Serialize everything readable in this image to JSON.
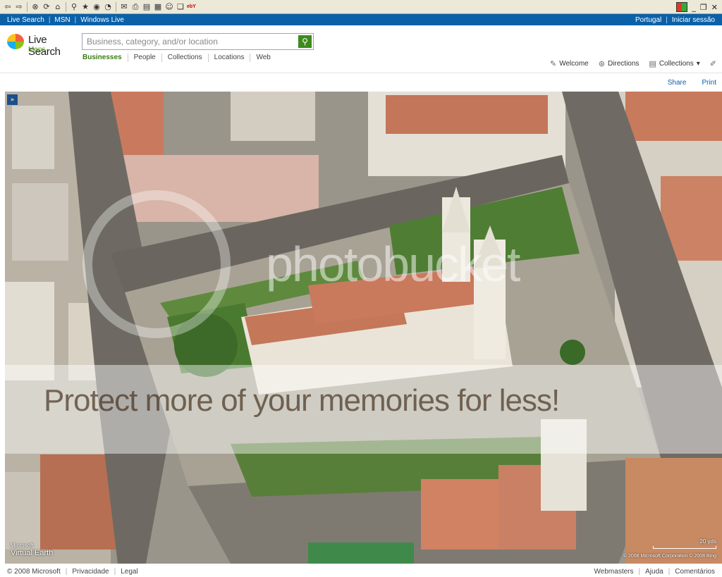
{
  "topbar": {
    "left_links": [
      "Live Search",
      "MSN",
      "Windows Live"
    ],
    "region": "Portugal",
    "signin": "Iniciar sessão"
  },
  "logo": {
    "brand": "Live Search",
    "product": "Maps"
  },
  "search": {
    "placeholder": "Business, category, and/or location"
  },
  "search_tabs": [
    "Businesses",
    "People",
    "Collections",
    "Locations",
    "Web"
  ],
  "actions": {
    "welcome": "Welcome",
    "directions": "Directions",
    "collections": "Collections"
  },
  "share": "Share",
  "print": "Print",
  "map": {
    "watermark_brand": "photobucket",
    "watermark_slogan": "Protect more of your memories for less!",
    "provider_small": "Microsoft",
    "provider": "Virtual Earth",
    "scale": "20 yds",
    "copyright": "© 2008 Microsoft Corporation   © 2008 Bing"
  },
  "footer": {
    "copyright": "© 2008 Microsoft",
    "privacy": "Privacidade",
    "legal": "Legal",
    "webmasters": "Webmasters",
    "help": "Ajuda",
    "comments": "Comentários"
  }
}
